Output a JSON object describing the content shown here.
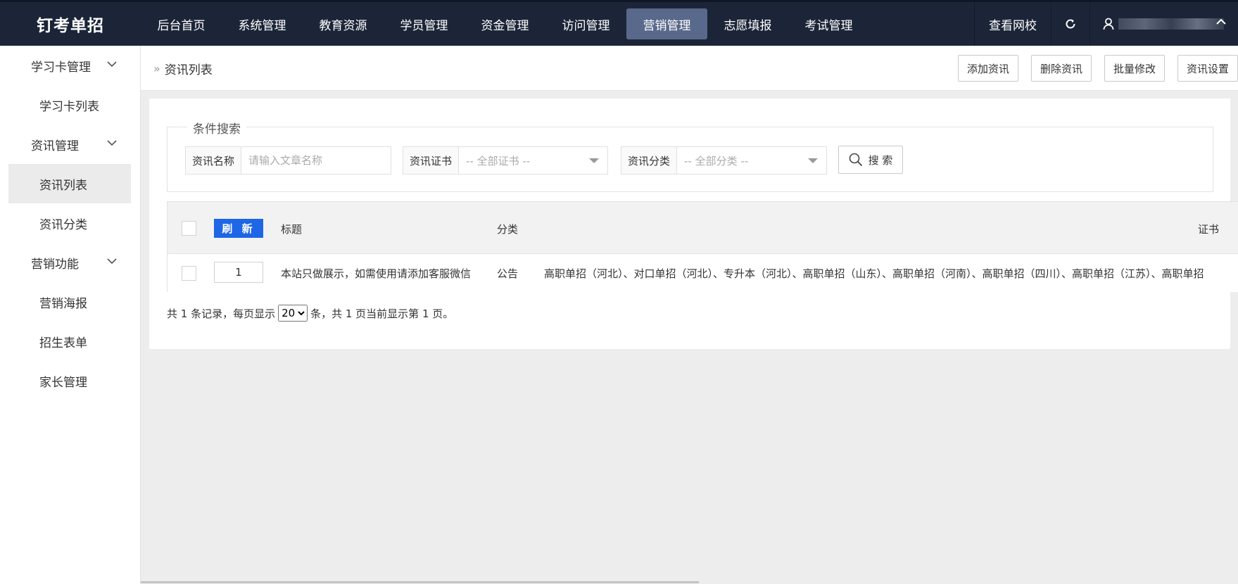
{
  "app": {
    "title": "钉考单招"
  },
  "nav": {
    "items": [
      {
        "label": "后台首页",
        "active": false
      },
      {
        "label": "系统管理",
        "active": false
      },
      {
        "label": "教育资源",
        "active": false
      },
      {
        "label": "学员管理",
        "active": false
      },
      {
        "label": "资金管理",
        "active": false
      },
      {
        "label": "访问管理",
        "active": false
      },
      {
        "label": "营销管理",
        "active": true
      },
      {
        "label": "志愿填报",
        "active": false
      },
      {
        "label": "考试管理",
        "active": false
      }
    ],
    "view_school": "查看网校"
  },
  "sidebar": {
    "groups": [
      {
        "label": "学习卡管理",
        "items": [
          {
            "label": "学习卡列表",
            "active": false
          }
        ]
      },
      {
        "label": "资讯管理",
        "items": [
          {
            "label": "资讯列表",
            "active": true
          },
          {
            "label": "资讯分类",
            "active": false
          }
        ]
      },
      {
        "label": "营销功能",
        "items": [
          {
            "label": "营销海报",
            "active": false
          },
          {
            "label": "招生表单",
            "active": false
          },
          {
            "label": "家长管理",
            "active": false
          }
        ]
      }
    ]
  },
  "breadcrumb": {
    "current": "资讯列表"
  },
  "actions": {
    "add": "添加资讯",
    "delete": "删除资讯",
    "batch_edit": "批量修改",
    "settings": "资讯设置"
  },
  "search": {
    "legend": "条件搜索",
    "name_label": "资讯名称",
    "name_placeholder": "请输入文章名称",
    "name_value": "",
    "cert_label": "资讯证书",
    "cert_selected": "-- 全部证书 --",
    "category_label": "资讯分类",
    "category_selected": "-- 全部分类 --",
    "search_button": "搜 索"
  },
  "table": {
    "refresh_button": "刷 新",
    "headers": {
      "title": "标题",
      "category": "分类",
      "certificate": "证书"
    },
    "rows": [
      {
        "order": "1",
        "title": "本站只做展示，如需使用请添加客服微信",
        "category": "公告",
        "certificate": "高职单招（河北）、对口单招（河北）、专升本（河北）、高职单招（山东）、高职单招（河南）、高职单招（四川）、高职单招（江苏）、高职单招"
      }
    ]
  },
  "pager": {
    "prefix": "共 1 条记录，每页显示",
    "page_size": "20",
    "suffix": "条，共 1 页当前显示第 1 页。"
  },
  "colors": {
    "topbar": "#1c2538",
    "nav_active": "#59698b",
    "primary": "#1e66e6"
  }
}
